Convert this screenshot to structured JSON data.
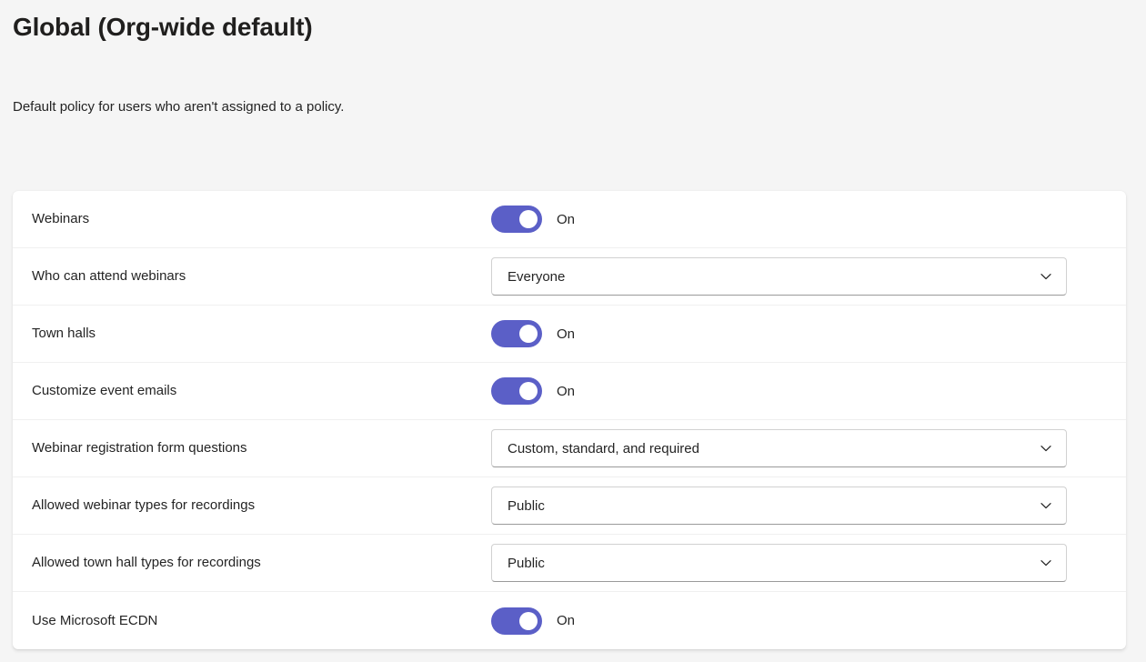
{
  "header": {
    "title": "Global (Org-wide default)",
    "subtitle": "Default policy for users who aren't assigned to a policy."
  },
  "colors": {
    "accent": "#5b5fc7",
    "page_background": "#f5f5f5",
    "card_background": "#ffffff",
    "text": "#242424",
    "title_text": "#201f1e",
    "row_divider": "#f0f0f0",
    "field_border": "#d1d1d1"
  },
  "settings": {
    "rows": [
      {
        "label": "Webinars",
        "control": "toggle",
        "state": "On",
        "checked": true
      },
      {
        "label": "Who can attend webinars",
        "control": "dropdown",
        "value": "Everyone"
      },
      {
        "label": "Town halls",
        "control": "toggle",
        "state": "On",
        "checked": true
      },
      {
        "label": "Customize event emails",
        "control": "toggle",
        "state": "On",
        "checked": true
      },
      {
        "label": "Webinar registration form questions",
        "control": "dropdown",
        "value": "Custom, standard, and required"
      },
      {
        "label": "Allowed webinar types for recordings",
        "control": "dropdown",
        "value": "Public"
      },
      {
        "label": "Allowed town hall types for recordings",
        "control": "dropdown",
        "value": "Public"
      },
      {
        "label": "Use Microsoft ECDN",
        "control": "toggle",
        "state": "On",
        "checked": true
      }
    ]
  }
}
